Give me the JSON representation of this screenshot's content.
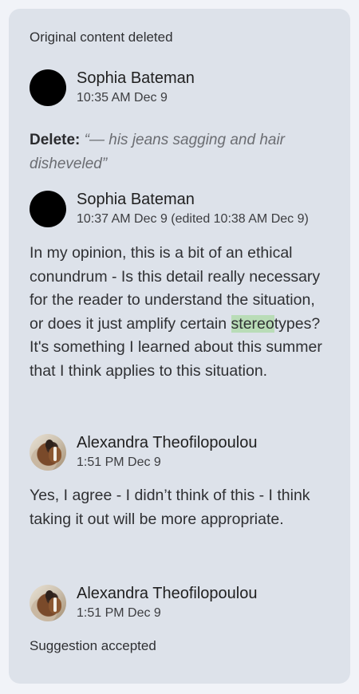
{
  "header_note": "Original content deleted",
  "comments": [
    {
      "author": "Sophia Bateman",
      "time": "10:35 AM Dec 9",
      "delete_label": "Delete:",
      "deleted_text": "“— his jeans sagging and hair disheveled”"
    },
    {
      "author": "Sophia Bateman",
      "time": "10:37 AM Dec 9 (edited 10:38 AM Dec 9)",
      "body_before": "In my opinion, this is a bit of an ethical conundrum - Is this detail really necessary for the reader to understand the situation, or does it just amplify certain ",
      "body_highlight": "stereo",
      "body_after": "types? It's something I learned about this summer that I think applies to this situation."
    },
    {
      "author": "Alexandra Theofilopoulou",
      "time": "1:51 PM Dec 9",
      "body": "Yes, I agree - I didn’t think of this - I think taking it out will be more appropriate."
    },
    {
      "author": "Alexandra Theofilopoulou",
      "time": "1:51 PM Dec 9"
    }
  ],
  "footer_note": "Suggestion accepted",
  "colors": {
    "card_background": "#dde2ea",
    "page_background": "#f1f3f8",
    "highlight": "#b9dcb7"
  }
}
